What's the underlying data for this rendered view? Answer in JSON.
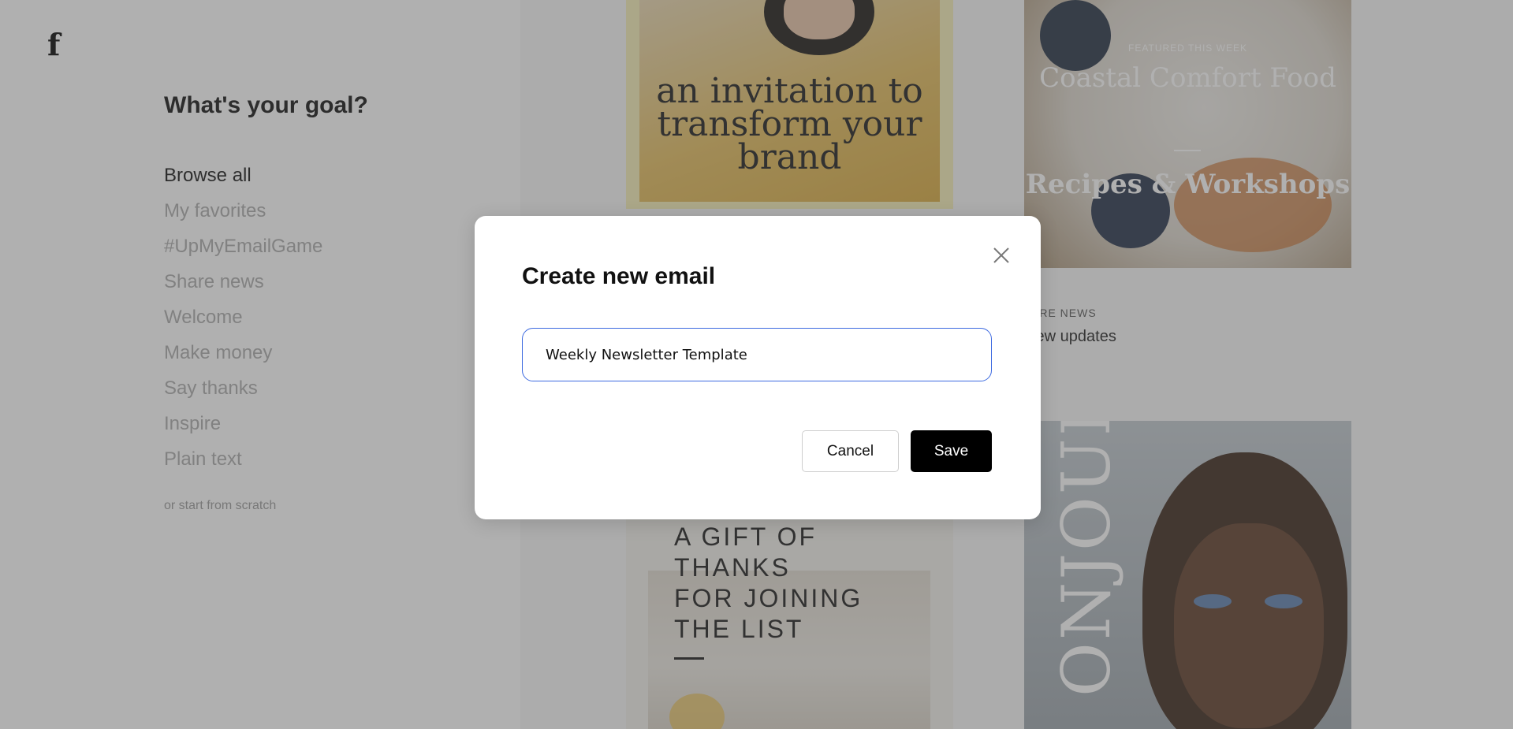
{
  "app": {
    "logo": "f"
  },
  "sidebar": {
    "title": "What's your goal?",
    "items": [
      {
        "label": "Browse all",
        "active": true
      },
      {
        "label": "My favorites"
      },
      {
        "label": "#UpMyEmailGame"
      },
      {
        "label": "Share news"
      },
      {
        "label": "Welcome"
      },
      {
        "label": "Make money"
      },
      {
        "label": "Say thanks"
      },
      {
        "label": "Inspire"
      },
      {
        "label": "Plain text"
      }
    ],
    "scratch_link": "or start from scratch"
  },
  "templates": {
    "card1": {
      "headline": "an invitation to transform your brand"
    },
    "card2": {
      "featured": "FEATURED THIS WEEK",
      "title": "Coastal Comfort Food",
      "subtitle": "Recipes & Workshops"
    },
    "share_news": {
      "tag": "ARE NEWS",
      "title": "few updates"
    },
    "card3": {
      "text": "A GIFT OF\nTHANKS\nFOR JOINING\nTHE LIST"
    },
    "card4": {
      "vertical_text": "ONJOUR"
    }
  },
  "modal": {
    "title": "Create new email",
    "name_value": "Weekly Newsletter Template",
    "cancel_label": "Cancel",
    "save_label": "Save"
  },
  "colors": {
    "accent_border": "#3d6ae0",
    "save_bg": "#000000",
    "overlay": "rgba(80,80,80,0.45)"
  }
}
